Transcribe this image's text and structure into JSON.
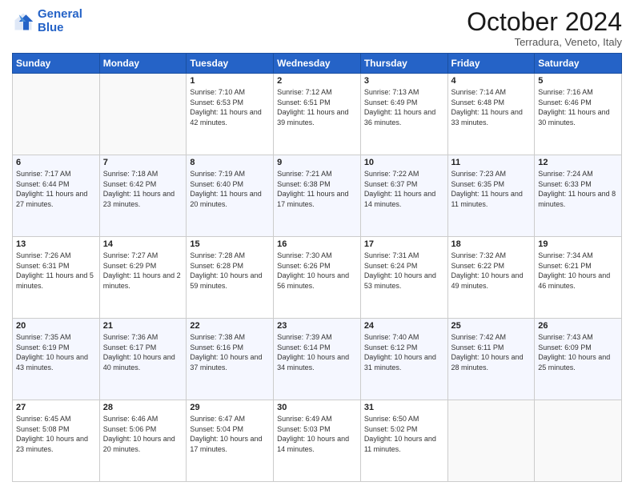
{
  "logo": {
    "line1": "General",
    "line2": "Blue"
  },
  "title": "October 2024",
  "subtitle": "Terradura, Veneto, Italy",
  "days_of_week": [
    "Sunday",
    "Monday",
    "Tuesday",
    "Wednesday",
    "Thursday",
    "Friday",
    "Saturday"
  ],
  "weeks": [
    [
      {
        "day": "",
        "sunrise": "",
        "sunset": "",
        "daylight": ""
      },
      {
        "day": "",
        "sunrise": "",
        "sunset": "",
        "daylight": ""
      },
      {
        "day": "1",
        "sunrise": "Sunrise: 7:10 AM",
        "sunset": "Sunset: 6:53 PM",
        "daylight": "Daylight: 11 hours and 42 minutes."
      },
      {
        "day": "2",
        "sunrise": "Sunrise: 7:12 AM",
        "sunset": "Sunset: 6:51 PM",
        "daylight": "Daylight: 11 hours and 39 minutes."
      },
      {
        "day": "3",
        "sunrise": "Sunrise: 7:13 AM",
        "sunset": "Sunset: 6:49 PM",
        "daylight": "Daylight: 11 hours and 36 minutes."
      },
      {
        "day": "4",
        "sunrise": "Sunrise: 7:14 AM",
        "sunset": "Sunset: 6:48 PM",
        "daylight": "Daylight: 11 hours and 33 minutes."
      },
      {
        "day": "5",
        "sunrise": "Sunrise: 7:16 AM",
        "sunset": "Sunset: 6:46 PM",
        "daylight": "Daylight: 11 hours and 30 minutes."
      }
    ],
    [
      {
        "day": "6",
        "sunrise": "Sunrise: 7:17 AM",
        "sunset": "Sunset: 6:44 PM",
        "daylight": "Daylight: 11 hours and 27 minutes."
      },
      {
        "day": "7",
        "sunrise": "Sunrise: 7:18 AM",
        "sunset": "Sunset: 6:42 PM",
        "daylight": "Daylight: 11 hours and 23 minutes."
      },
      {
        "day": "8",
        "sunrise": "Sunrise: 7:19 AM",
        "sunset": "Sunset: 6:40 PM",
        "daylight": "Daylight: 11 hours and 20 minutes."
      },
      {
        "day": "9",
        "sunrise": "Sunrise: 7:21 AM",
        "sunset": "Sunset: 6:38 PM",
        "daylight": "Daylight: 11 hours and 17 minutes."
      },
      {
        "day": "10",
        "sunrise": "Sunrise: 7:22 AM",
        "sunset": "Sunset: 6:37 PM",
        "daylight": "Daylight: 11 hours and 14 minutes."
      },
      {
        "day": "11",
        "sunrise": "Sunrise: 7:23 AM",
        "sunset": "Sunset: 6:35 PM",
        "daylight": "Daylight: 11 hours and 11 minutes."
      },
      {
        "day": "12",
        "sunrise": "Sunrise: 7:24 AM",
        "sunset": "Sunset: 6:33 PM",
        "daylight": "Daylight: 11 hours and 8 minutes."
      }
    ],
    [
      {
        "day": "13",
        "sunrise": "Sunrise: 7:26 AM",
        "sunset": "Sunset: 6:31 PM",
        "daylight": "Daylight: 11 hours and 5 minutes."
      },
      {
        "day": "14",
        "sunrise": "Sunrise: 7:27 AM",
        "sunset": "Sunset: 6:29 PM",
        "daylight": "Daylight: 11 hours and 2 minutes."
      },
      {
        "day": "15",
        "sunrise": "Sunrise: 7:28 AM",
        "sunset": "Sunset: 6:28 PM",
        "daylight": "Daylight: 10 hours and 59 minutes."
      },
      {
        "day": "16",
        "sunrise": "Sunrise: 7:30 AM",
        "sunset": "Sunset: 6:26 PM",
        "daylight": "Daylight: 10 hours and 56 minutes."
      },
      {
        "day": "17",
        "sunrise": "Sunrise: 7:31 AM",
        "sunset": "Sunset: 6:24 PM",
        "daylight": "Daylight: 10 hours and 53 minutes."
      },
      {
        "day": "18",
        "sunrise": "Sunrise: 7:32 AM",
        "sunset": "Sunset: 6:22 PM",
        "daylight": "Daylight: 10 hours and 49 minutes."
      },
      {
        "day": "19",
        "sunrise": "Sunrise: 7:34 AM",
        "sunset": "Sunset: 6:21 PM",
        "daylight": "Daylight: 10 hours and 46 minutes."
      }
    ],
    [
      {
        "day": "20",
        "sunrise": "Sunrise: 7:35 AM",
        "sunset": "Sunset: 6:19 PM",
        "daylight": "Daylight: 10 hours and 43 minutes."
      },
      {
        "day": "21",
        "sunrise": "Sunrise: 7:36 AM",
        "sunset": "Sunset: 6:17 PM",
        "daylight": "Daylight: 10 hours and 40 minutes."
      },
      {
        "day": "22",
        "sunrise": "Sunrise: 7:38 AM",
        "sunset": "Sunset: 6:16 PM",
        "daylight": "Daylight: 10 hours and 37 minutes."
      },
      {
        "day": "23",
        "sunrise": "Sunrise: 7:39 AM",
        "sunset": "Sunset: 6:14 PM",
        "daylight": "Daylight: 10 hours and 34 minutes."
      },
      {
        "day": "24",
        "sunrise": "Sunrise: 7:40 AM",
        "sunset": "Sunset: 6:12 PM",
        "daylight": "Daylight: 10 hours and 31 minutes."
      },
      {
        "day": "25",
        "sunrise": "Sunrise: 7:42 AM",
        "sunset": "Sunset: 6:11 PM",
        "daylight": "Daylight: 10 hours and 28 minutes."
      },
      {
        "day": "26",
        "sunrise": "Sunrise: 7:43 AM",
        "sunset": "Sunset: 6:09 PM",
        "daylight": "Daylight: 10 hours and 25 minutes."
      }
    ],
    [
      {
        "day": "27",
        "sunrise": "Sunrise: 6:45 AM",
        "sunset": "Sunset: 5:08 PM",
        "daylight": "Daylight: 10 hours and 23 minutes."
      },
      {
        "day": "28",
        "sunrise": "Sunrise: 6:46 AM",
        "sunset": "Sunset: 5:06 PM",
        "daylight": "Daylight: 10 hours and 20 minutes."
      },
      {
        "day": "29",
        "sunrise": "Sunrise: 6:47 AM",
        "sunset": "Sunset: 5:04 PM",
        "daylight": "Daylight: 10 hours and 17 minutes."
      },
      {
        "day": "30",
        "sunrise": "Sunrise: 6:49 AM",
        "sunset": "Sunset: 5:03 PM",
        "daylight": "Daylight: 10 hours and 14 minutes."
      },
      {
        "day": "31",
        "sunrise": "Sunrise: 6:50 AM",
        "sunset": "Sunset: 5:02 PM",
        "daylight": "Daylight: 10 hours and 11 minutes."
      },
      {
        "day": "",
        "sunrise": "",
        "sunset": "",
        "daylight": ""
      },
      {
        "day": "",
        "sunrise": "",
        "sunset": "",
        "daylight": ""
      }
    ]
  ]
}
